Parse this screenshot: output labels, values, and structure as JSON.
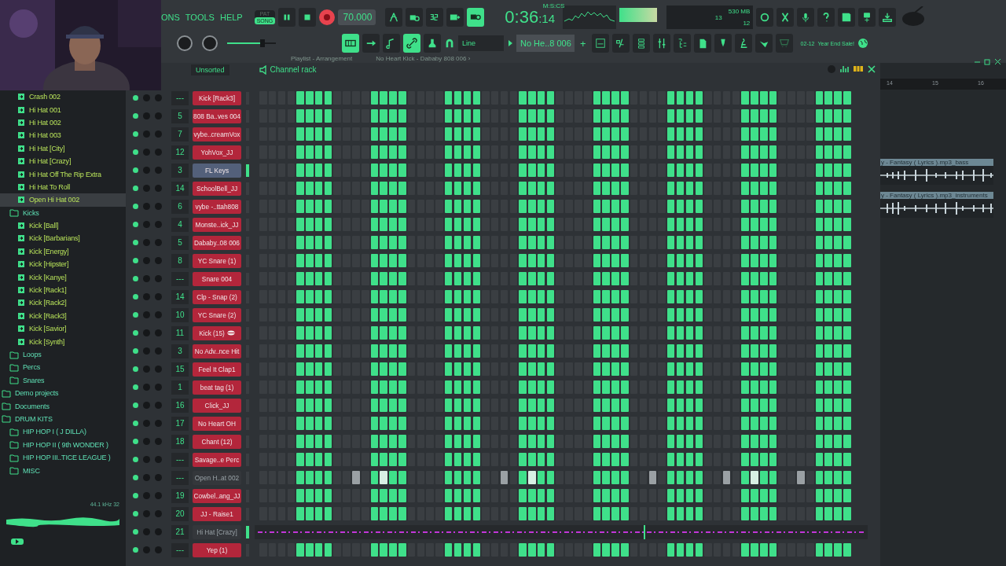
{
  "menu": [
    "ONS",
    "TOOLS",
    "HELP"
  ],
  "transport": {
    "modes": [
      {
        "label": "PAT",
        "selected": false
      },
      {
        "label": "SONG",
        "selected": true
      }
    ],
    "tempo": "70.000"
  },
  "toggles_top": [
    {
      "kind": "wait",
      "on": false
    },
    {
      "kind": "metronome",
      "on": false
    },
    {
      "kind": "countdown",
      "on": false
    },
    {
      "kind": "keyboard",
      "on": false
    },
    {
      "kind": "loop",
      "on": true
    }
  ],
  "time": {
    "main": "0:36",
    "sub": ":14",
    "format": "M:S:CS"
  },
  "cpu": {
    "polyphony": "13",
    "memory": "530 MB",
    "voices": "12"
  },
  "toggles_bottom": [
    {
      "kind": "piano",
      "on": true
    },
    {
      "kind": "arrow",
      "on": false
    },
    {
      "kind": "note",
      "on": false
    },
    {
      "kind": "link",
      "on": true
    },
    {
      "kind": "stamp",
      "on": false
    }
  ],
  "snap": "Line",
  "pattern": "No He..8 006",
  "pattern_add": "+",
  "news": {
    "date": "02-12",
    "text": "Year End Sale!"
  },
  "hint": [
    "Playlist - Arrangement",
    "No Heart Kick - Dababy 808 006 ›"
  ],
  "browser": {
    "tree": [
      {
        "children": [
          {
            "children": [
              {
                "label": "Crash 002",
                "kind": "file",
                "selected": false
              },
              {
                "label": "Hi Hat 001",
                "kind": "file",
                "selected": false
              },
              {
                "label": "Hi Hat 002",
                "kind": "file",
                "selected": false
              },
              {
                "label": "Hi Hat 003",
                "kind": "file",
                "selected": false
              },
              {
                "label": "Hi Hat [City]",
                "kind": "file",
                "selected": false
              },
              {
                "label": "Hi Hat [Crazy]",
                "kind": "file",
                "selected": false
              },
              {
                "label": "Hi Hat Off The Rip Extra",
                "kind": "file",
                "selected": false
              },
              {
                "label": "Hi Hat To Roll",
                "kind": "file",
                "selected": false
              },
              {
                "label": "Open Hi Hat 002",
                "kind": "file",
                "selected": true
              }
            ]
          },
          {
            "label": "Kicks",
            "kind": "folder",
            "selected": false,
            "children": [
              {
                "label": "Kick [Ball]",
                "kind": "file",
                "selected": false
              },
              {
                "label": "Kick [Barbarians]",
                "kind": "file",
                "selected": false
              },
              {
                "label": "Kick [Energy]",
                "kind": "file",
                "selected": false
              },
              {
                "label": "Kick [Hipster]",
                "kind": "file",
                "selected": false
              },
              {
                "label": "Kick [Kanye]",
                "kind": "file",
                "selected": false
              },
              {
                "label": "Kick [Rack1]",
                "kind": "file",
                "selected": false
              },
              {
                "label": "Kick [Rack2]",
                "kind": "file",
                "selected": false
              },
              {
                "label": "Kick [Rack3]",
                "kind": "file",
                "selected": false
              },
              {
                "label": "Kick [Savior]",
                "kind": "file",
                "selected": false
              },
              {
                "label": "Kick [Synth]",
                "kind": "file",
                "selected": false
              }
            ]
          },
          {
            "label": "Loops",
            "kind": "folder",
            "selected": false
          },
          {
            "label": "Percs",
            "kind": "folder",
            "selected": false
          },
          {
            "label": "Snares",
            "kind": "folder",
            "selected": false
          }
        ]
      },
      {
        "label": "Demo projects",
        "kind": "folder",
        "selected": false
      },
      {
        "label": "Documents",
        "kind": "folder",
        "selected": false
      },
      {
        "label": "DRUM KITS",
        "kind": "folder",
        "selected": false,
        "children": [
          {
            "label": "HIP HOP I ( J DILLA)",
            "kind": "folder",
            "selected": false
          },
          {
            "label": "HIP HOP II ( 9th WONDER )",
            "kind": "folder",
            "selected": false
          },
          {
            "label": "HIP HOP III..TICE LEAGUE )",
            "kind": "folder",
            "selected": false
          },
          {
            "label": "MISC",
            "kind": "folder",
            "selected": false
          }
        ]
      }
    ],
    "info": "44.1 kHz 32"
  },
  "rack": {
    "filter": "Unsorted",
    "title": "Channel rack",
    "channels": [
      {
        "name": "Kick [Rack3]",
        "mixer": "---",
        "color": "#b3263b",
        "selected": false,
        "marked": false,
        "kind": "steps",
        "steps": [
          false,
          false,
          false,
          false,
          true,
          true,
          true,
          true,
          false,
          false,
          false,
          false,
          true,
          true,
          true,
          true,
          false,
          false,
          false,
          false,
          true,
          true,
          true,
          true,
          false,
          false,
          false,
          false,
          true,
          true,
          true,
          true,
          false,
          false,
          false,
          false,
          true,
          true,
          true,
          true,
          false,
          false,
          false,
          false,
          true,
          true,
          true,
          true,
          false,
          false,
          false,
          false,
          true,
          true,
          true,
          true,
          false,
          false,
          false,
          false,
          true,
          true,
          true,
          true
        ]
      },
      {
        "name": "808 Ba..ves 004",
        "mixer": "5",
        "color": "#b3263b",
        "selected": false,
        "marked": false,
        "kind": "steps",
        "steps": [
          false,
          false,
          false,
          false,
          true,
          true,
          true,
          true,
          false,
          false,
          false,
          false,
          true,
          true,
          true,
          true,
          false,
          false,
          false,
          false,
          true,
          true,
          true,
          true,
          false,
          false,
          false,
          false,
          true,
          true,
          true,
          true,
          false,
          false,
          false,
          false,
          true,
          true,
          true,
          true,
          false,
          false,
          false,
          false,
          true,
          true,
          true,
          true,
          false,
          false,
          false,
          false,
          true,
          true,
          true,
          true,
          false,
          false,
          false,
          false,
          true,
          true,
          true,
          true
        ]
      },
      {
        "name": "vybe..creamVox",
        "mixer": "7",
        "color": "#b3263b",
        "selected": false,
        "marked": false,
        "kind": "steps",
        "steps": [
          false,
          false,
          false,
          false,
          true,
          true,
          true,
          true,
          false,
          false,
          false,
          false,
          true,
          true,
          true,
          true,
          false,
          false,
          false,
          false,
          true,
          true,
          true,
          true,
          false,
          false,
          false,
          false,
          true,
          true,
          true,
          true,
          false,
          false,
          false,
          false,
          true,
          true,
          true,
          true,
          false,
          false,
          false,
          false,
          true,
          true,
          true,
          true,
          false,
          false,
          false,
          false,
          true,
          true,
          true,
          true,
          false,
          false,
          false,
          false,
          true,
          true,
          true,
          true
        ]
      },
      {
        "name": "YohVox_JJ",
        "mixer": "12",
        "color": "#b3263b",
        "selected": false,
        "marked": false,
        "kind": "steps",
        "steps": [
          false,
          false,
          false,
          false,
          true,
          true,
          true,
          true,
          false,
          false,
          false,
          false,
          true,
          true,
          true,
          true,
          false,
          false,
          false,
          false,
          true,
          true,
          true,
          true,
          false,
          false,
          false,
          false,
          true,
          true,
          true,
          true,
          false,
          false,
          false,
          false,
          true,
          true,
          true,
          true,
          false,
          false,
          false,
          false,
          true,
          true,
          true,
          true,
          false,
          false,
          false,
          false,
          true,
          true,
          true,
          true,
          false,
          false,
          false,
          false,
          true,
          true,
          true,
          true
        ]
      },
      {
        "name": "FL Keys",
        "mixer": "3",
        "color": "#53607a",
        "selected": true,
        "marked": false,
        "kind": "steps",
        "steps": [
          false,
          false,
          false,
          false,
          true,
          true,
          true,
          true,
          false,
          false,
          false,
          false,
          true,
          true,
          true,
          true,
          false,
          false,
          false,
          false,
          true,
          true,
          true,
          true,
          false,
          false,
          false,
          false,
          true,
          true,
          true,
          true,
          false,
          false,
          false,
          false,
          true,
          true,
          true,
          true,
          false,
          false,
          false,
          false,
          true,
          true,
          true,
          true,
          false,
          false,
          false,
          false,
          true,
          true,
          true,
          true,
          false,
          false,
          false,
          false,
          true,
          true,
          true,
          true
        ]
      },
      {
        "name": "SchoolBell_JJ",
        "mixer": "14",
        "color": "#b3263b",
        "selected": false,
        "marked": false,
        "kind": "steps",
        "steps": [
          false,
          false,
          false,
          false,
          true,
          true,
          true,
          true,
          false,
          false,
          false,
          false,
          true,
          true,
          true,
          true,
          false,
          false,
          false,
          false,
          true,
          true,
          true,
          true,
          false,
          false,
          false,
          false,
          true,
          true,
          true,
          true,
          false,
          false,
          false,
          false,
          true,
          true,
          true,
          true,
          false,
          false,
          false,
          false,
          true,
          true,
          true,
          true,
          false,
          false,
          false,
          false,
          true,
          true,
          true,
          true,
          false,
          false,
          false,
          false,
          true,
          true,
          true,
          true
        ]
      },
      {
        "name": "vybe -..ttah808",
        "mixer": "6",
        "color": "#b3263b",
        "selected": false,
        "marked": false,
        "kind": "steps",
        "steps": [
          false,
          false,
          false,
          false,
          true,
          true,
          true,
          true,
          false,
          false,
          false,
          false,
          true,
          true,
          true,
          true,
          false,
          false,
          false,
          false,
          true,
          true,
          true,
          true,
          false,
          false,
          false,
          false,
          true,
          true,
          true,
          true,
          false,
          false,
          false,
          false,
          true,
          true,
          true,
          true,
          false,
          false,
          false,
          false,
          true,
          true,
          true,
          true,
          false,
          false,
          false,
          false,
          true,
          true,
          true,
          true,
          false,
          false,
          false,
          false,
          true,
          true,
          true,
          true
        ]
      },
      {
        "name": "Monste..ick_JJ",
        "mixer": "4",
        "color": "#b3263b",
        "selected": false,
        "marked": false,
        "kind": "steps",
        "steps": [
          false,
          false,
          false,
          false,
          true,
          true,
          true,
          true,
          false,
          false,
          false,
          false,
          true,
          true,
          true,
          true,
          false,
          false,
          false,
          false,
          true,
          true,
          true,
          true,
          false,
          false,
          false,
          false,
          true,
          true,
          true,
          true,
          false,
          false,
          false,
          false,
          true,
          true,
          true,
          true,
          false,
          false,
          false,
          false,
          true,
          true,
          true,
          true,
          false,
          false,
          false,
          false,
          true,
          true,
          true,
          true,
          false,
          false,
          false,
          false,
          true,
          true,
          true,
          true
        ]
      },
      {
        "name": "Dababy..08 006",
        "mixer": "5",
        "color": "#b3263b",
        "selected": false,
        "marked": false,
        "kind": "steps",
        "steps": [
          false,
          false,
          false,
          false,
          true,
          true,
          true,
          true,
          false,
          false,
          false,
          false,
          true,
          true,
          true,
          true,
          false,
          false,
          false,
          false,
          true,
          true,
          true,
          true,
          false,
          false,
          false,
          false,
          true,
          true,
          true,
          true,
          false,
          false,
          false,
          false,
          true,
          true,
          true,
          true,
          false,
          false,
          false,
          false,
          true,
          true,
          true,
          true,
          false,
          false,
          false,
          false,
          true,
          true,
          true,
          true,
          false,
          false,
          false,
          false,
          true,
          true,
          true,
          true
        ]
      },
      {
        "name": "YC Snare (1)",
        "mixer": "8",
        "color": "#b3263b",
        "selected": false,
        "marked": false,
        "kind": "steps",
        "steps": [
          false,
          false,
          false,
          false,
          true,
          true,
          true,
          true,
          false,
          false,
          false,
          false,
          true,
          true,
          true,
          true,
          false,
          false,
          false,
          false,
          true,
          true,
          true,
          true,
          false,
          false,
          false,
          false,
          true,
          true,
          true,
          true,
          false,
          false,
          false,
          false,
          true,
          true,
          true,
          true,
          false,
          false,
          false,
          false,
          true,
          true,
          true,
          true,
          false,
          false,
          false,
          false,
          true,
          true,
          true,
          true,
          false,
          false,
          false,
          false,
          true,
          true,
          true,
          true
        ]
      },
      {
        "name": "Snare 004",
        "mixer": "---",
        "color": "#b3263b",
        "selected": false,
        "marked": false,
        "kind": "steps",
        "steps": [
          false,
          false,
          false,
          false,
          true,
          true,
          true,
          true,
          false,
          false,
          false,
          false,
          true,
          true,
          true,
          true,
          false,
          false,
          false,
          false,
          true,
          true,
          true,
          true,
          false,
          false,
          false,
          false,
          true,
          true,
          true,
          true,
          false,
          false,
          false,
          false,
          true,
          true,
          true,
          true,
          false,
          false,
          false,
          false,
          true,
          true,
          true,
          true,
          false,
          false,
          false,
          false,
          true,
          true,
          true,
          true,
          false,
          false,
          false,
          false,
          true,
          true,
          true,
          true
        ]
      },
      {
        "name": "Clp - Snap (2)",
        "mixer": "14",
        "color": "#b3263b",
        "selected": false,
        "marked": false,
        "kind": "steps",
        "steps": [
          false,
          false,
          false,
          false,
          true,
          true,
          true,
          true,
          false,
          false,
          false,
          false,
          true,
          true,
          true,
          true,
          false,
          false,
          false,
          false,
          true,
          true,
          true,
          true,
          false,
          false,
          false,
          false,
          true,
          true,
          true,
          true,
          false,
          false,
          false,
          false,
          true,
          true,
          true,
          true,
          false,
          false,
          false,
          false,
          true,
          true,
          true,
          true,
          false,
          false,
          false,
          false,
          true,
          true,
          true,
          true,
          false,
          false,
          false,
          false,
          true,
          true,
          true,
          true
        ]
      },
      {
        "name": "YC Snare (2)",
        "mixer": "10",
        "color": "#b3263b",
        "selected": false,
        "marked": false,
        "kind": "steps",
        "steps": [
          false,
          false,
          false,
          false,
          true,
          true,
          true,
          true,
          false,
          false,
          false,
          false,
          true,
          true,
          true,
          true,
          false,
          false,
          false,
          false,
          true,
          true,
          true,
          true,
          false,
          false,
          false,
          false,
          true,
          true,
          true,
          true,
          false,
          false,
          false,
          false,
          true,
          true,
          true,
          true,
          false,
          false,
          false,
          false,
          true,
          true,
          true,
          true,
          false,
          false,
          false,
          false,
          true,
          true,
          true,
          true,
          false,
          false,
          false,
          false,
          true,
          true,
          true,
          true
        ]
      },
      {
        "name": "Kick (15)",
        "mixer": "11",
        "color": "#b3263b",
        "selected": false,
        "marked": true,
        "kind": "steps",
        "steps": [
          false,
          false,
          false,
          false,
          true,
          true,
          true,
          true,
          false,
          false,
          false,
          false,
          true,
          true,
          true,
          true,
          false,
          false,
          false,
          false,
          true,
          true,
          true,
          true,
          false,
          false,
          false,
          false,
          true,
          true,
          true,
          true,
          false,
          false,
          false,
          false,
          true,
          true,
          true,
          true,
          false,
          false,
          false,
          false,
          true,
          true,
          true,
          true,
          false,
          false,
          false,
          false,
          true,
          true,
          true,
          true,
          false,
          false,
          false,
          false,
          true,
          true,
          true,
          true
        ]
      },
      {
        "name": "No Adv..nce Hit",
        "mixer": "3",
        "color": "#b3263b",
        "selected": false,
        "marked": false,
        "kind": "steps",
        "steps": [
          false,
          false,
          false,
          false,
          true,
          true,
          true,
          true,
          false,
          false,
          false,
          false,
          true,
          true,
          true,
          true,
          false,
          false,
          false,
          false,
          true,
          true,
          true,
          true,
          false,
          false,
          false,
          false,
          true,
          true,
          true,
          true,
          false,
          false,
          false,
          false,
          true,
          true,
          true,
          true,
          false,
          false,
          false,
          false,
          true,
          true,
          true,
          true,
          false,
          false,
          false,
          false,
          true,
          true,
          true,
          true,
          false,
          false,
          false,
          false,
          true,
          true,
          true,
          true
        ]
      },
      {
        "name": "Feel It Clap1",
        "mixer": "15",
        "color": "#b3263b",
        "selected": false,
        "marked": false,
        "kind": "steps",
        "steps": [
          false,
          false,
          false,
          false,
          true,
          true,
          true,
          true,
          false,
          false,
          false,
          false,
          true,
          true,
          true,
          true,
          false,
          false,
          false,
          false,
          true,
          true,
          true,
          true,
          false,
          false,
          false,
          false,
          true,
          true,
          true,
          true,
          false,
          false,
          false,
          false,
          true,
          true,
          true,
          true,
          false,
          false,
          false,
          false,
          true,
          true,
          true,
          true,
          false,
          false,
          false,
          false,
          true,
          true,
          true,
          true,
          false,
          false,
          false,
          false,
          true,
          true,
          true,
          true
        ]
      },
      {
        "name": "beat tag (1)",
        "mixer": "1",
        "color": "#b3263b",
        "selected": false,
        "marked": false,
        "kind": "steps",
        "steps": [
          false,
          false,
          false,
          false,
          true,
          true,
          true,
          true,
          false,
          false,
          false,
          false,
          true,
          true,
          true,
          true,
          false,
          false,
          false,
          false,
          true,
          true,
          true,
          true,
          false,
          false,
          false,
          false,
          true,
          true,
          true,
          true,
          false,
          false,
          false,
          false,
          true,
          true,
          true,
          true,
          false,
          false,
          false,
          false,
          true,
          true,
          true,
          true,
          false,
          false,
          false,
          false,
          true,
          true,
          true,
          true,
          false,
          false,
          false,
          false,
          true,
          true,
          true,
          true
        ]
      },
      {
        "name": "Click_JJ",
        "mixer": "16",
        "color": "#b3263b",
        "selected": false,
        "marked": false,
        "kind": "steps",
        "steps": [
          false,
          false,
          false,
          false,
          true,
          true,
          true,
          true,
          false,
          false,
          false,
          false,
          true,
          true,
          true,
          true,
          false,
          false,
          false,
          false,
          true,
          true,
          true,
          true,
          false,
          false,
          false,
          false,
          true,
          true,
          true,
          true,
          false,
          false,
          false,
          false,
          true,
          true,
          true,
          true,
          false,
          false,
          false,
          false,
          true,
          true,
          true,
          true,
          false,
          false,
          false,
          false,
          true,
          true,
          true,
          true,
          false,
          false,
          false,
          false,
          true,
          true,
          true,
          true
        ]
      },
      {
        "name": "No Heart OH",
        "mixer": "17",
        "color": "#b3263b",
        "selected": false,
        "marked": false,
        "kind": "steps",
        "steps": [
          false,
          false,
          false,
          false,
          true,
          true,
          true,
          true,
          false,
          false,
          false,
          false,
          true,
          true,
          true,
          true,
          false,
          false,
          false,
          false,
          true,
          true,
          true,
          true,
          false,
          false,
          false,
          false,
          true,
          true,
          true,
          true,
          false,
          false,
          false,
          false,
          true,
          true,
          true,
          true,
          false,
          false,
          false,
          false,
          true,
          true,
          true,
          true,
          false,
          false,
          false,
          false,
          true,
          true,
          true,
          true,
          false,
          false,
          false,
          false,
          true,
          true,
          true,
          true
        ]
      },
      {
        "name": "Chant (12)",
        "mixer": "18",
        "color": "#b3263b",
        "selected": false,
        "marked": false,
        "kind": "steps",
        "steps": [
          false,
          false,
          false,
          false,
          true,
          true,
          true,
          true,
          false,
          false,
          false,
          false,
          true,
          true,
          true,
          true,
          false,
          false,
          false,
          false,
          true,
          true,
          true,
          true,
          false,
          false,
          false,
          false,
          true,
          true,
          true,
          true,
          false,
          false,
          false,
          false,
          true,
          true,
          true,
          true,
          false,
          false,
          false,
          false,
          true,
          true,
          true,
          true,
          false,
          false,
          false,
          false,
          true,
          true,
          true,
          true,
          false,
          false,
          false,
          false,
          true,
          true,
          true,
          true
        ]
      },
      {
        "name": "Savage..e Perc",
        "mixer": "---",
        "color": "#b3263b",
        "selected": false,
        "marked": false,
        "kind": "steps",
        "steps": [
          false,
          false,
          false,
          false,
          true,
          true,
          true,
          true,
          false,
          false,
          false,
          false,
          true,
          true,
          true,
          true,
          false,
          false,
          false,
          false,
          true,
          true,
          true,
          true,
          false,
          false,
          false,
          false,
          true,
          true,
          true,
          true,
          false,
          false,
          false,
          false,
          true,
          true,
          true,
          true,
          false,
          false,
          false,
          false,
          true,
          true,
          true,
          true,
          false,
          false,
          false,
          false,
          true,
          true,
          true,
          true,
          false,
          false,
          false,
          false,
          true,
          true,
          true,
          true
        ]
      },
      {
        "name": "Open H..at 002",
        "mixer": "---",
        "color": "#34373b",
        "selected": false,
        "marked": false,
        "kind": "steps",
        "steps": [
          false,
          false,
          false,
          false,
          true,
          true,
          true,
          true,
          false,
          false,
          false,
          false,
          true,
          true,
          true,
          true,
          false,
          false,
          false,
          false,
          true,
          true,
          true,
          true,
          false,
          false,
          false,
          false,
          true,
          true,
          true,
          true,
          false,
          false,
          false,
          false,
          true,
          true,
          true,
          true,
          false,
          false,
          false,
          false,
          true,
          true,
          true,
          true,
          false,
          false,
          false,
          false,
          true,
          true,
          true,
          true,
          false,
          false,
          false,
          false,
          true,
          true,
          true,
          true
        ],
        "accents": [
          false,
          false,
          false,
          false,
          false,
          false,
          false,
          false,
          false,
          false,
          true,
          false,
          false,
          true,
          false,
          false,
          false,
          false,
          false,
          false,
          false,
          false,
          false,
          false,
          false,
          false,
          true,
          false,
          false,
          true,
          false,
          false,
          false,
          false,
          false,
          false,
          false,
          false,
          false,
          false,
          false,
          false,
          true,
          false,
          false,
          false,
          false,
          false,
          false,
          false,
          true,
          false,
          false,
          true,
          false,
          false,
          false,
          false,
          true,
          false,
          false,
          false,
          false,
          false
        ]
      },
      {
        "name": "Cowbel..ang_JJ",
        "mixer": "19",
        "color": "#b3263b",
        "selected": false,
        "marked": false,
        "kind": "steps",
        "steps": [
          false,
          false,
          false,
          false,
          true,
          true,
          true,
          true,
          false,
          false,
          false,
          false,
          true,
          true,
          true,
          true,
          false,
          false,
          false,
          false,
          true,
          true,
          true,
          true,
          false,
          false,
          false,
          false,
          true,
          true,
          true,
          true,
          false,
          false,
          false,
          false,
          true,
          true,
          true,
          true,
          false,
          false,
          false,
          false,
          true,
          true,
          true,
          true,
          false,
          false,
          false,
          false,
          true,
          true,
          true,
          true,
          false,
          false,
          false,
          false,
          true,
          true,
          true,
          true
        ]
      },
      {
        "name": "JJ - Raise1",
        "mixer": "20",
        "color": "#b3263b",
        "selected": false,
        "marked": false,
        "kind": "steps",
        "steps": [
          false,
          false,
          false,
          false,
          true,
          true,
          true,
          true,
          false,
          false,
          false,
          false,
          true,
          true,
          true,
          true,
          false,
          false,
          false,
          false,
          true,
          true,
          true,
          true,
          false,
          false,
          false,
          false,
          true,
          true,
          true,
          true,
          false,
          false,
          false,
          false,
          true,
          true,
          true,
          true,
          false,
          false,
          false,
          false,
          true,
          true,
          true,
          true,
          false,
          false,
          false,
          false,
          true,
          true,
          true,
          true,
          false,
          false,
          false,
          false,
          true,
          true,
          true,
          true
        ]
      },
      {
        "name": "Hi Hat [Crazy]",
        "mixer": "21",
        "color": "#34373b",
        "selected": true,
        "marked": false,
        "kind": "piano_roll"
      },
      {
        "name": "Yep (1)",
        "mixer": "---",
        "color": "#b3263b",
        "selected": false,
        "marked": false,
        "kind": "steps",
        "steps": [
          false,
          false,
          false,
          false,
          true,
          true,
          true,
          true,
          false,
          false,
          false,
          false,
          true,
          true,
          true,
          true,
          false,
          false,
          false,
          false,
          true,
          true,
          true,
          true,
          false,
          false,
          false,
          false,
          true,
          true,
          true,
          true,
          false,
          false,
          false,
          false,
          true,
          true,
          true,
          true,
          false,
          false,
          false,
          false,
          true,
          true,
          true,
          true,
          false,
          false,
          false,
          false,
          true,
          true,
          true,
          true,
          false,
          false,
          false,
          false,
          true,
          true,
          true,
          true
        ]
      }
    ]
  },
  "playlist": {
    "bars": [
      "14",
      "15",
      "16"
    ],
    "clips": [
      "y - Fantasy ( Lyrics ).mp3_bass",
      "y - Fantasy ( Lyrics ).mp3_instruments"
    ]
  }
}
